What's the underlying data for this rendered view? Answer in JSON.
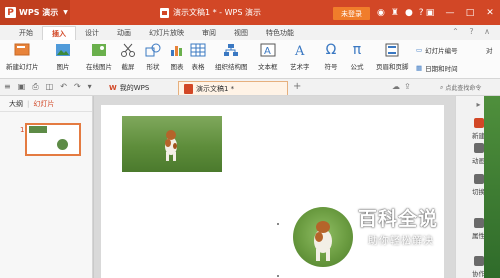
{
  "titlebar": {
    "app_name": "WPS 演示",
    "doc_title": "演示文稿1 * - WPS 演示",
    "login": "未登录"
  },
  "menu": {
    "tabs": [
      "开始",
      "插入",
      "设计",
      "动画",
      "幻灯片放映",
      "审阅",
      "视图",
      "特色功能"
    ],
    "active_tab": "插入"
  },
  "ribbon": {
    "new_slide": "新建幻灯片",
    "picture": "图片",
    "online_picture": "在线图片",
    "screenshot": "截屏",
    "shapes": "形状",
    "chart": "图表",
    "table": "表格",
    "org_chart": "组织结构图",
    "textbox": "文本框",
    "wordart": "艺术字",
    "symbol": "符号",
    "formula": "公式",
    "header_footer": "页眉和页脚",
    "slide_number": "幻灯片编号",
    "date_time": "日期和时间",
    "object": "对"
  },
  "docbar": {
    "wps_tab": "我的WPS",
    "doc_tab": "演示文稿1 *",
    "search_placeholder": "点此查找命令"
  },
  "leftpanel": {
    "outline": "大纲",
    "slides": "幻灯片",
    "slide_number": "1"
  },
  "rightpane": {
    "items": [
      "新建",
      "动画",
      "切换",
      "属性",
      "协作"
    ]
  },
  "watermark": {
    "title": "百科全说",
    "subtitle": "助你轻松解决"
  },
  "colors": {
    "accent": "#d24726",
    "login": "#f07d2b"
  }
}
